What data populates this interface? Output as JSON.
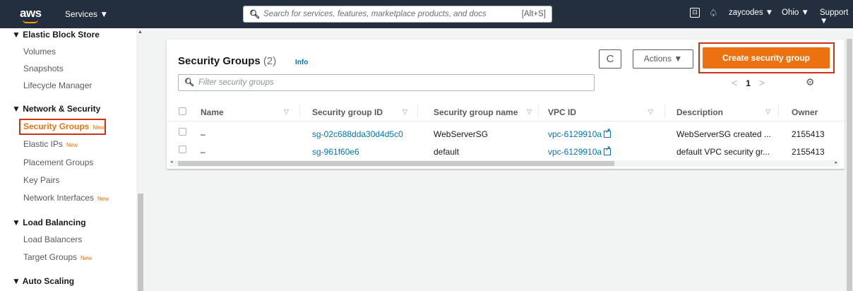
{
  "topnav": {
    "logo": "aws",
    "services_label": "Services ▼",
    "search_placeholder": "Search for services, features, marketplace products, and docs",
    "search_shortcut": "[Alt+S]",
    "cloudshell_glyph": "⊡",
    "bell_glyph": "♤",
    "user": "zaycodes ▼",
    "region": "Ohio ▼",
    "support": "Support ▼"
  },
  "sidebar": {
    "sections": [
      {
        "title": "▼ Elastic Block Store",
        "items": [
          {
            "label": "Volumes"
          },
          {
            "label": "Snapshots"
          },
          {
            "label": "Lifecycle Manager"
          }
        ]
      },
      {
        "title": "▼ Network & Security",
        "items": [
          {
            "label": "Security Groups",
            "badge": "New",
            "active": true
          },
          {
            "label": "Elastic IPs",
            "badge": "New"
          },
          {
            "label": "Placement Groups"
          },
          {
            "label": "Key Pairs"
          },
          {
            "label": "Network Interfaces",
            "badge": "New"
          }
        ]
      },
      {
        "title": "▼ Load Balancing",
        "items": [
          {
            "label": "Load Balancers"
          },
          {
            "label": "Target Groups",
            "badge": "New"
          }
        ]
      },
      {
        "title": "▼ Auto Scaling",
        "items": []
      }
    ]
  },
  "main": {
    "title": "Security Groups",
    "count": "(2)",
    "info_label": "Info",
    "refresh_glyph": "C",
    "actions_label": "Actions ▼",
    "create_label": "Create security group",
    "filter_placeholder": "Filter security groups",
    "pager": {
      "prev": "<",
      "page": "1",
      "next": ">"
    },
    "settings_glyph": "⚙",
    "columns": [
      "Name",
      "Security group ID",
      "Security group name",
      "VPC ID",
      "Description",
      "Owner"
    ],
    "rows": [
      {
        "name": "–",
        "sg_id": "sg-02c688dda30d4d5c0",
        "sg_name": "WebServerSG",
        "vpc_id": "vpc-6129910a",
        "description": "WebServerSG created ...",
        "owner": "2155413"
      },
      {
        "name": "–",
        "sg_id": "sg-961f60e6",
        "sg_name": "default",
        "vpc_id": "vpc-6129910a",
        "description": "default VPC security gr...",
        "owner": "2155413"
      }
    ]
  },
  "colors": {
    "nav_bg": "#232f3e",
    "accent": "#ec7211",
    "highlight_border": "#d13212",
    "link": "#0073bb"
  }
}
